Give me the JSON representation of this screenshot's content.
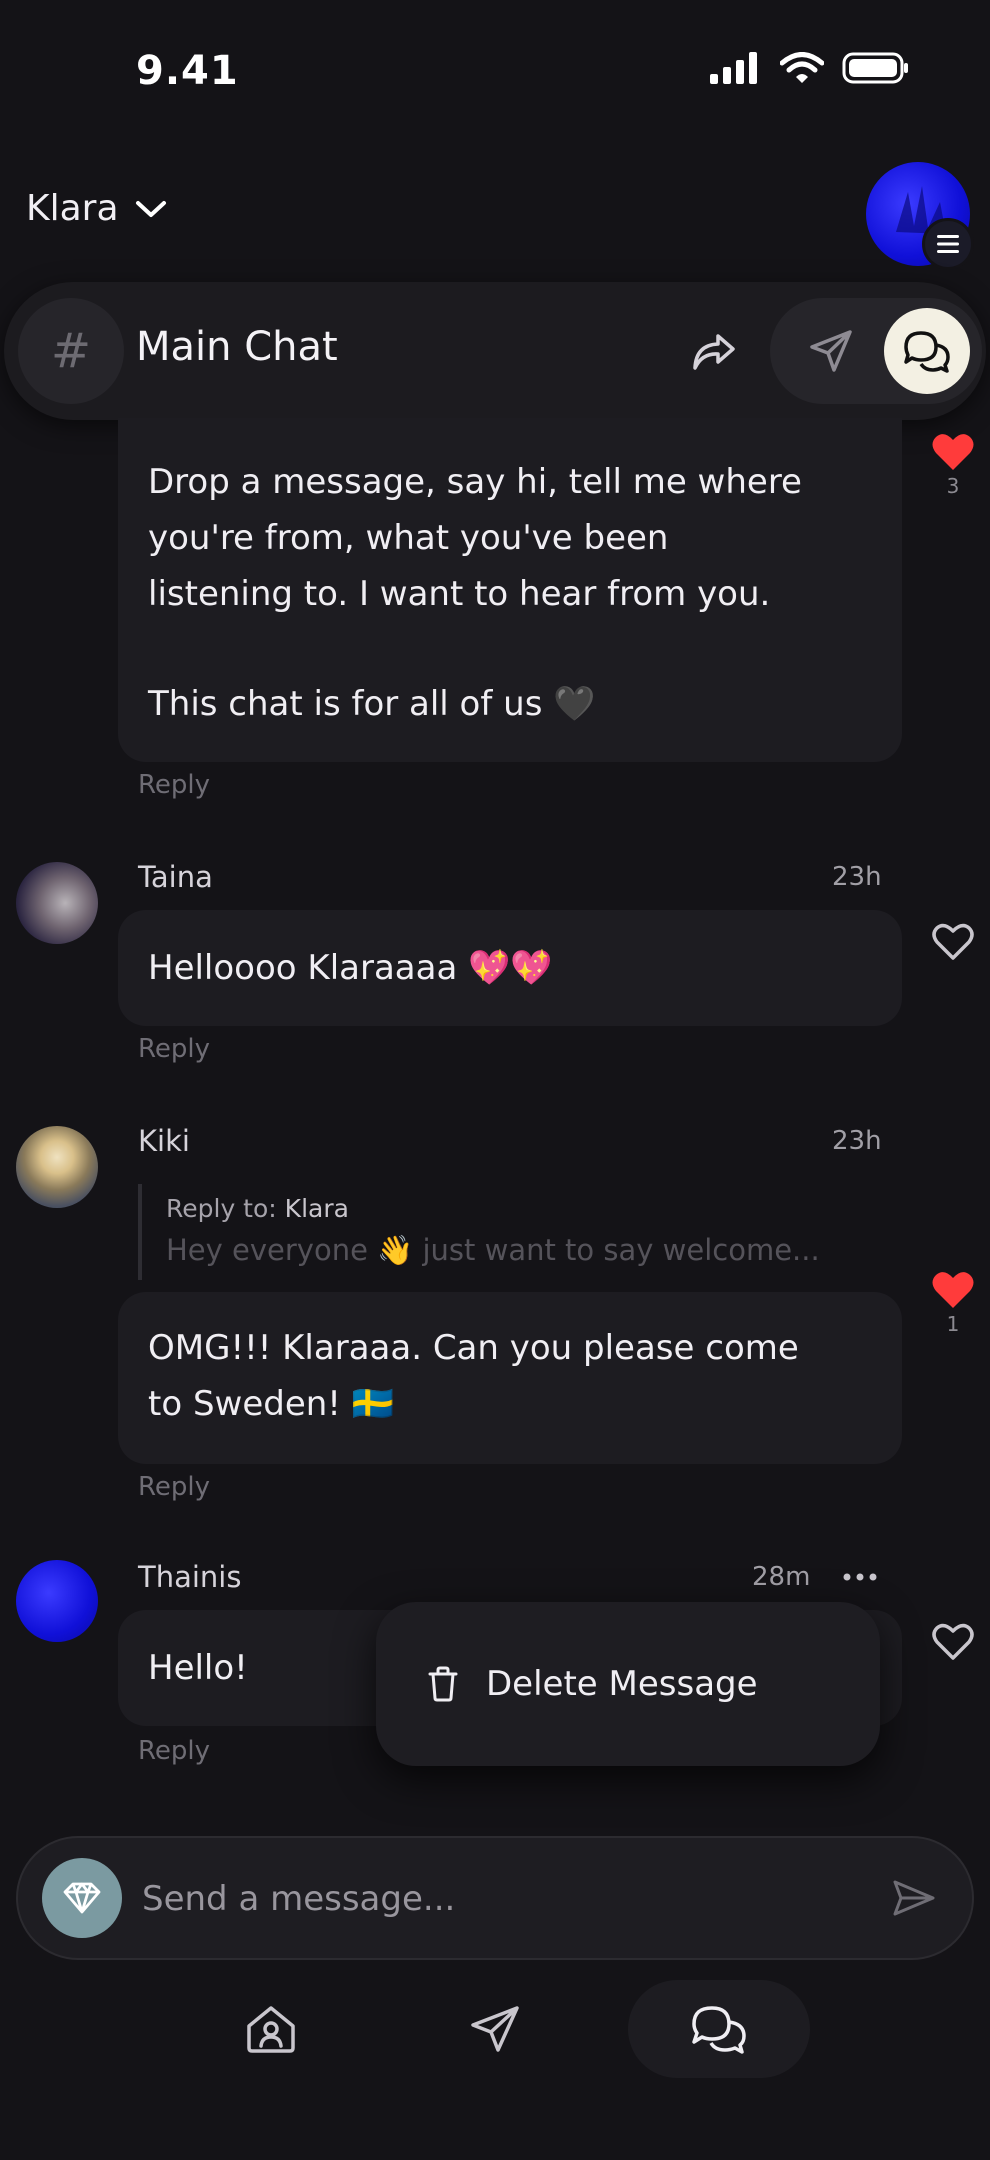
{
  "status_bar": {
    "time": "9.41"
  },
  "header": {
    "channel_owner": "Klara"
  },
  "chat_bar": {
    "title": "Main Chat"
  },
  "messages": [
    {
      "lines": [
        "Drop a message, say hi, tell me where",
        "you're from, what you've been",
        "listening to. I want to hear from you.",
        "",
        "This chat is for all of us 🖤"
      ],
      "reply": "Reply",
      "likes": "3",
      "liked": true
    },
    {
      "author": "Taina",
      "time": "23h",
      "text": "Helloooo Klaraaaa 💖💖",
      "reply": "Reply",
      "liked": false
    },
    {
      "author": "Kiki",
      "time": "23h",
      "quote_label": "Reply to:",
      "quote_author": "Klara",
      "quote_text": "Hey everyone 👋 just want to say welcome...",
      "lines": [
        "OMG!!! Klaraaa. Can you please come",
        "to Sweden! 🇸🇪"
      ],
      "reply": "Reply",
      "likes": "1",
      "liked": true
    },
    {
      "author": "Thainis",
      "time": "28m",
      "text": "Hello!",
      "reply": "Reply",
      "liked": false
    }
  ],
  "popover": {
    "delete_label": "Delete Message"
  },
  "composer": {
    "placeholder": "Send a message..."
  },
  "colors": {
    "heart": "#ff3b3b",
    "background": "#141317",
    "bubble": "#1d1c21",
    "active_chip": "#f3f0e3",
    "gem": "#7b9aa1"
  },
  "icons": [
    "hash-icon",
    "share-icon",
    "send-icon",
    "chat-bubbles-icon",
    "chevron-down-icon",
    "menu-icon",
    "heart-icon",
    "more-icon",
    "trash-icon",
    "gem-icon",
    "home-icon"
  ]
}
